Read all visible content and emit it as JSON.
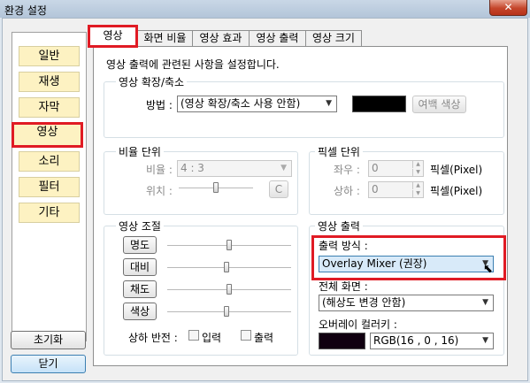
{
  "window": {
    "title": "환경 설정",
    "close_label": "✕"
  },
  "nav": {
    "items": [
      {
        "label": "일반"
      },
      {
        "label": "재생"
      },
      {
        "label": "자막"
      },
      {
        "label": "영상"
      },
      {
        "label": "소리"
      },
      {
        "label": "필터"
      },
      {
        "label": "기타"
      }
    ],
    "selected": "영상"
  },
  "footer": {
    "reset_label": "초기화",
    "close_label": "닫기"
  },
  "tabs": [
    {
      "label": "영상"
    },
    {
      "label": "화면 비율"
    },
    {
      "label": "영상 효과"
    },
    {
      "label": "영상 출력"
    },
    {
      "label": "영상 크기"
    }
  ],
  "panel": {
    "description": "영상 출력에 관련된 사항을 설정합니다.",
    "resize": {
      "group_label": "영상 확장/축소",
      "method_label": "방법 :",
      "method_value": "(영상 확장/축소 사용 안함)",
      "margin_color_label": "여백 색상",
      "margin_color": "#000000"
    },
    "ratio": {
      "group_label": "비율 단위",
      "ratio_label": "비율 :",
      "ratio_value": "4 : 3",
      "position_label": "위치 :",
      "center_label": "C",
      "position_level": 0.5
    },
    "pixel": {
      "group_label": "픽셀 단위",
      "lr_label": "좌우 :",
      "lr_value": "0",
      "ud_label": "상하 :",
      "ud_value": "0",
      "unit_label_1": "픽셀(Pixel)",
      "unit_label_2": "픽셀(Pixel)"
    },
    "adjust": {
      "group_label": "영상 조절",
      "sliders": [
        {
          "label": "명도",
          "level": 0.5
        },
        {
          "label": "대비",
          "level": 0.48
        },
        {
          "label": "채도",
          "level": 0.5
        },
        {
          "label": "색상",
          "level": 0.48
        }
      ],
      "flip_label": "상하 반전 :",
      "input_label": "입력",
      "output_label": "출력"
    },
    "output": {
      "group_label": "영상 출력",
      "method_label": "출력 방식 :",
      "method_value": "Overlay Mixer (권장)",
      "fullscreen_label": "전체 화면 :",
      "fullscreen_value": "(해상도 변경 안함)",
      "overlay_color_label": "오버레이 컬러키 :",
      "overlay_color_value": "RGB(16 , 0 , 16)",
      "overlay_color": "#100010"
    }
  },
  "colors": {
    "highlight": "#e01b24",
    "nav_button": "#fdf2c2"
  }
}
